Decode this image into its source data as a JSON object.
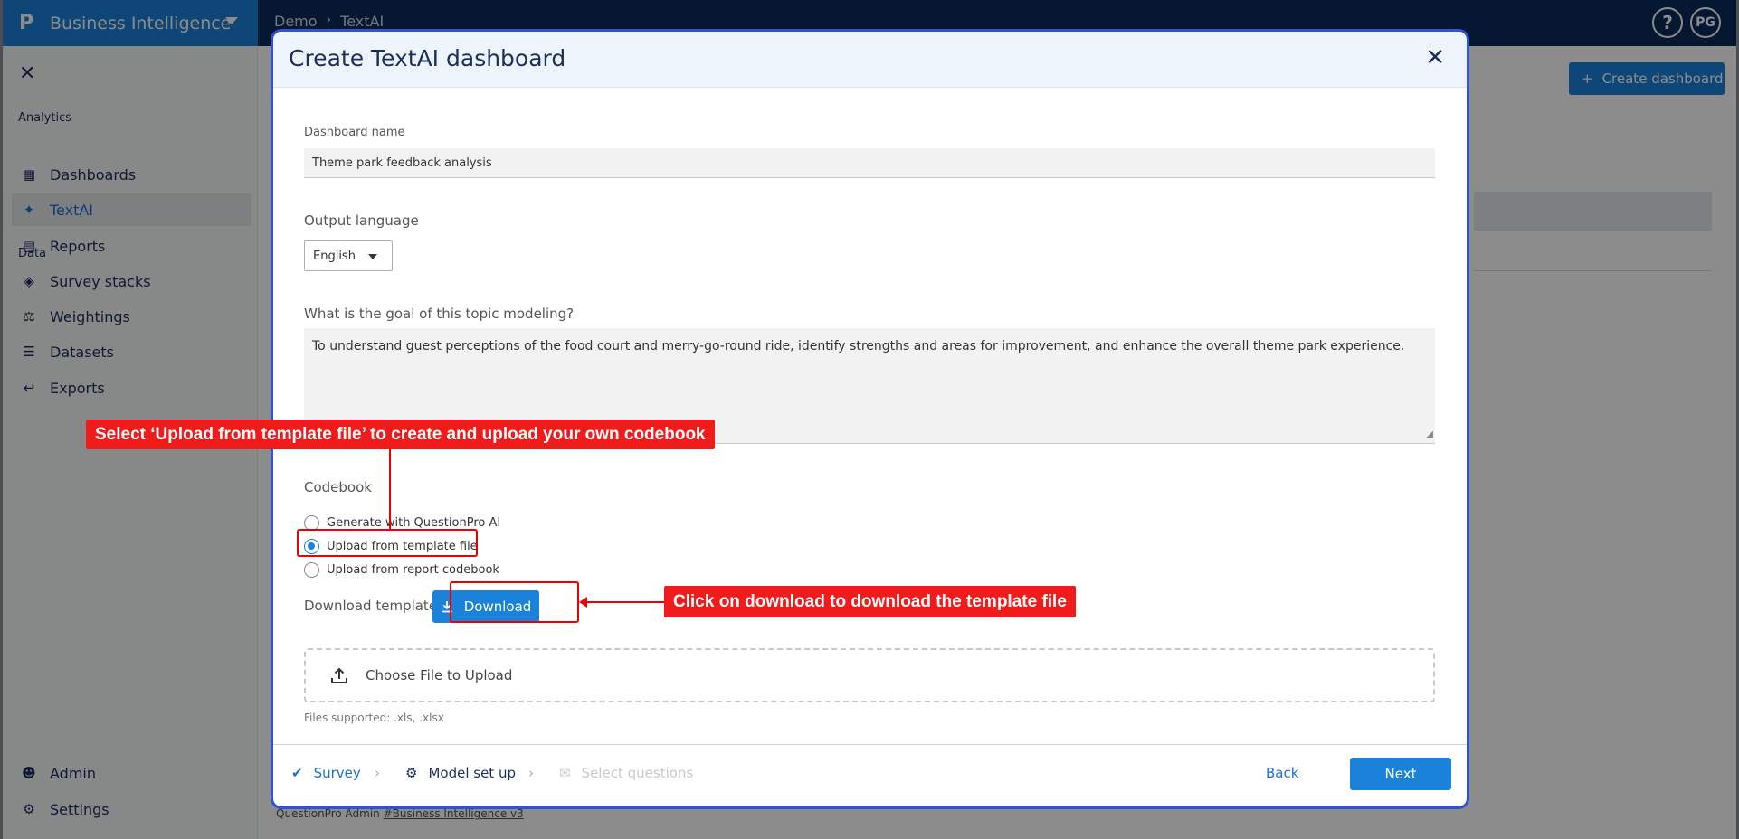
{
  "app": {
    "brand_logo": "P",
    "brand_name": "Business Intelligence",
    "breadcrumbs": [
      "Demo",
      "TextAI"
    ],
    "help_label": "?",
    "user_initials": "PG",
    "create_dashboard_label": "Create dashboard",
    "footer_text": "QuestionPro Admin",
    "footer_link": "#Business Intelligence v3"
  },
  "sidebar": {
    "sections": {
      "analytics": "Analytics",
      "data": "Data"
    },
    "items": [
      {
        "label": "Dashboards",
        "icon": "dashboards-icon"
      },
      {
        "label": "TextAI",
        "icon": "sparkle-icon",
        "active": true
      },
      {
        "label": "Reports",
        "icon": "report-icon"
      },
      {
        "label": "Survey stacks",
        "icon": "stack-icon"
      },
      {
        "label": "Weightings",
        "icon": "scale-icon"
      },
      {
        "label": "Datasets",
        "icon": "list-icon"
      },
      {
        "label": "Exports",
        "icon": "export-icon"
      },
      {
        "label": "Admin",
        "icon": "admin-icon"
      },
      {
        "label": "Settings",
        "icon": "gear-icon"
      }
    ]
  },
  "modal": {
    "title": "Create TextAI dashboard",
    "dashboard_name_label": "Dashboard name",
    "dashboard_name_value": "Theme park feedback analysis",
    "output_language_label": "Output language",
    "output_language_value": "English",
    "goal_label": "What is the goal of this topic modeling?",
    "goal_value": "To understand guest perceptions of the food court and merry-go-round ride, identify strengths and areas for improvement, and enhance the overall theme park experience.",
    "codebook_label": "Codebook",
    "codebook_options": [
      {
        "label": "Generate with QuestionPro AI",
        "checked": false
      },
      {
        "label": "Upload from template file",
        "checked": true
      },
      {
        "label": "Upload from report codebook",
        "checked": false
      }
    ],
    "download_template_label": "Download template file",
    "download_button": "Download",
    "upload_label": "Choose File to Upload",
    "files_supported": "Files supported: .xls, .xlsx",
    "steps": [
      {
        "label": "Survey",
        "state": "done"
      },
      {
        "label": "Model set up",
        "state": "current"
      },
      {
        "label": "Select questions",
        "state": "upcoming"
      }
    ],
    "back_button": "Back",
    "next_button": "Next"
  },
  "annotations": {
    "callout_upload": "Select ‘Upload from template file’ to create and upload your own codebook",
    "callout_download": "Click on download to download the template file",
    "color": "#f01c1c"
  }
}
